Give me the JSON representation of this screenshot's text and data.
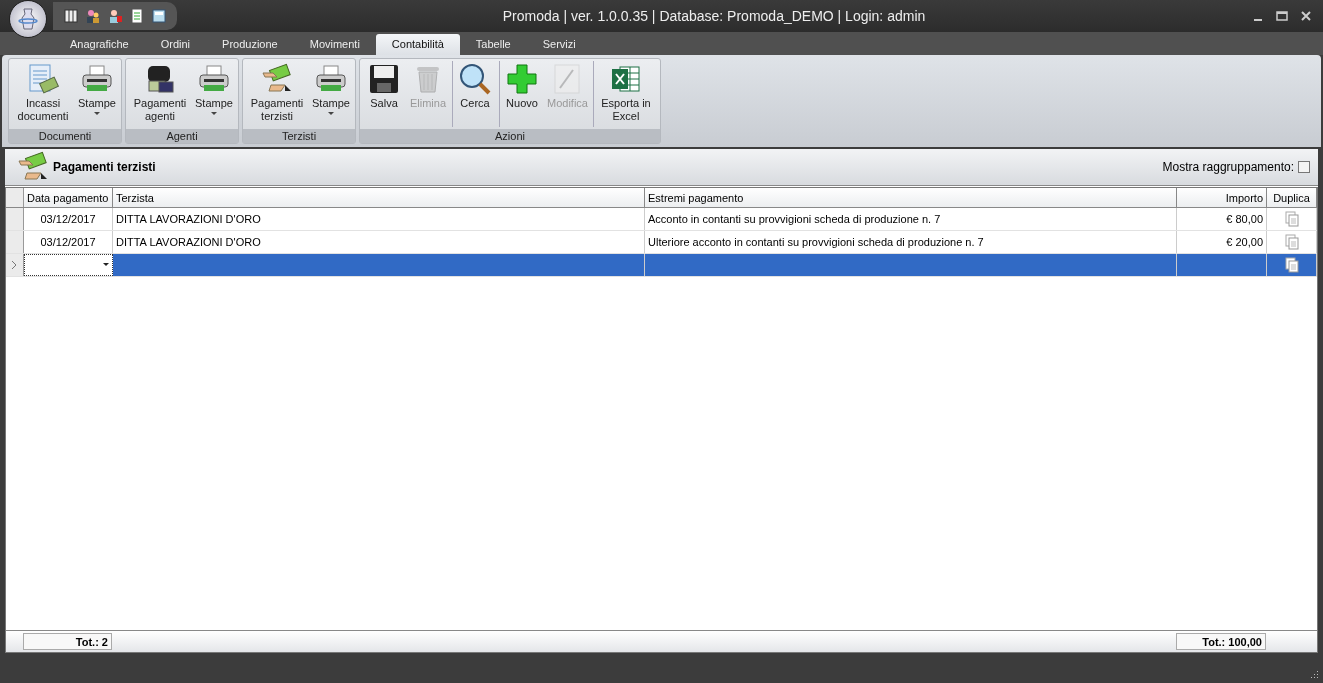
{
  "window": {
    "title": "Promoda | ver. 1.0.0.35 | Database: Promoda_DEMO | Login: admin"
  },
  "tabs": [
    {
      "label": "Anagrafiche",
      "selected": false
    },
    {
      "label": "Ordini",
      "selected": false
    },
    {
      "label": "Produzione",
      "selected": false
    },
    {
      "label": "Movimenti",
      "selected": false
    },
    {
      "label": "Contabilità",
      "selected": true
    },
    {
      "label": "Tabelle",
      "selected": false
    },
    {
      "label": "Servizi",
      "selected": false
    }
  ],
  "ribbon_groups": [
    {
      "label": "Documenti",
      "buttons": [
        {
          "label": "Incassi documenti",
          "kind": "receipt",
          "dropdown": false,
          "disabled": false,
          "separated": false
        },
        {
          "label": "Stampe",
          "kind": "printer",
          "dropdown": true,
          "disabled": false,
          "separated": false
        }
      ]
    },
    {
      "label": "Agenti",
      "buttons": [
        {
          "label": "Pagamenti agenti",
          "kind": "wallet",
          "dropdown": false,
          "disabled": false,
          "separated": false
        },
        {
          "label": "Stampe",
          "kind": "printer",
          "dropdown": true,
          "disabled": false,
          "separated": false
        }
      ]
    },
    {
      "label": "Terzisti",
      "buttons": [
        {
          "label": "Pagamenti terzisti",
          "kind": "money",
          "dropdown": false,
          "disabled": false,
          "separated": false
        },
        {
          "label": "Stampe",
          "kind": "printer",
          "dropdown": true,
          "disabled": false,
          "separated": false
        }
      ]
    },
    {
      "label": "Azioni",
      "buttons": [
        {
          "label": "Salva",
          "kind": "floppy",
          "dropdown": false,
          "disabled": false,
          "separated": false
        },
        {
          "label": "Elimina",
          "kind": "trash",
          "dropdown": false,
          "disabled": true,
          "separated": false
        },
        {
          "label": "Cerca",
          "kind": "magnifier",
          "dropdown": false,
          "disabled": false,
          "separated": true
        },
        {
          "label": "Nuovo",
          "kind": "plus",
          "dropdown": false,
          "disabled": false,
          "separated": true
        },
        {
          "label": "Modifica",
          "kind": "pencil",
          "dropdown": false,
          "disabled": true,
          "separated": false
        },
        {
          "label": "Esporta in Excel",
          "kind": "excel",
          "dropdown": false,
          "disabled": false,
          "separated": true
        }
      ]
    }
  ],
  "panel": {
    "title": "Pagamenti terzisti",
    "group_toggle": {
      "label": "Mostra raggruppamento:",
      "checked": false
    }
  },
  "table": {
    "columns": [
      "Data pagamento",
      "Terzista",
      "Estremi pagamento",
      "Importo",
      "Duplica"
    ],
    "rows": [
      {
        "data": "03/12/2017",
        "terzista": "DITTA LAVORAZIONI D'ORO",
        "estremi": "Acconto in contanti su provvigioni scheda di produzione n. 7",
        "importo": "€ 80,00",
        "selected": false,
        "new": false
      },
      {
        "data": "03/12/2017",
        "terzista": "DITTA LAVORAZIONI D'ORO",
        "estremi": "Ulteriore acconto in contanti su provvigioni scheda di produzione n. 7",
        "importo": "€ 20,00",
        "selected": false,
        "new": false
      },
      {
        "selected": true,
        "new": true
      }
    ],
    "totals": {
      "count": "Tot.: 2",
      "amount": "Tot.: 100,00"
    }
  }
}
